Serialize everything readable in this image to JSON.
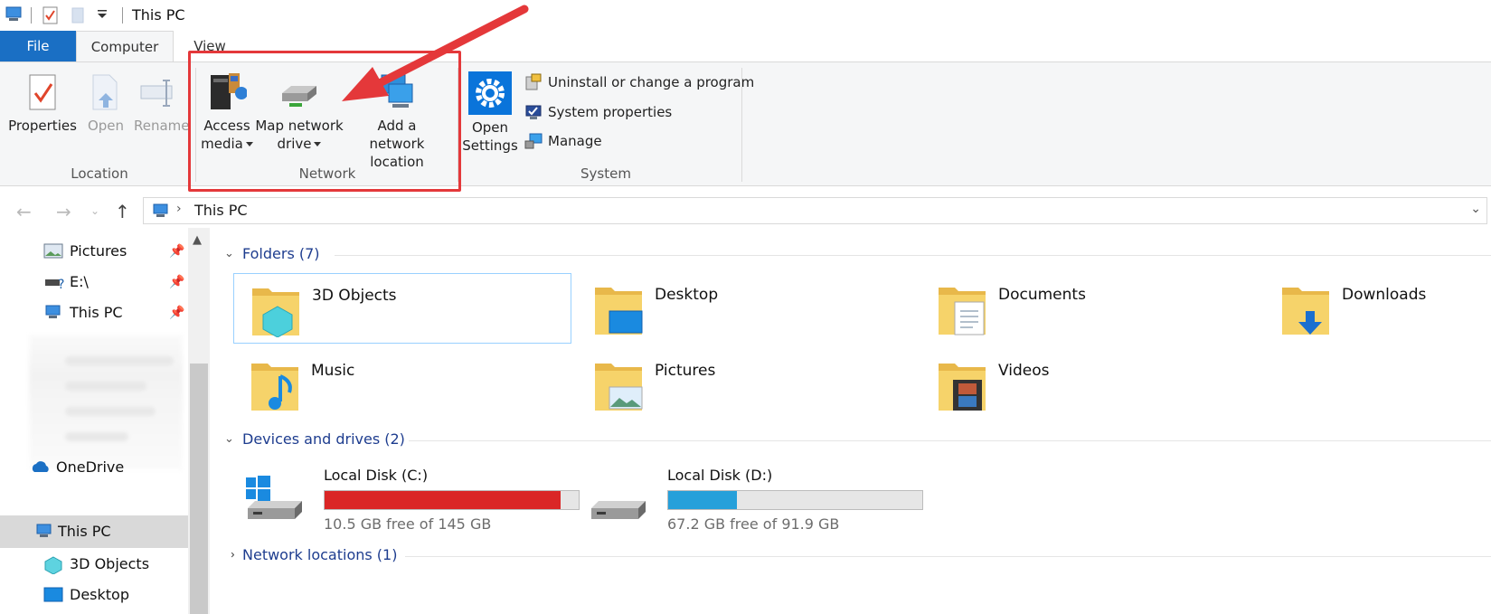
{
  "window": {
    "title": "This PC"
  },
  "tabs": {
    "file": "File",
    "computer": "Computer",
    "view": "View"
  },
  "ribbon": {
    "location": {
      "label": "Location",
      "properties": "Properties",
      "open": "Open",
      "rename": "Rename"
    },
    "network": {
      "label": "Network",
      "access_media": [
        "Access",
        "media"
      ],
      "map_network_drive": [
        "Map network",
        "drive"
      ],
      "add_network_location": [
        "Add a network",
        "location"
      ]
    },
    "system": {
      "label": "System",
      "open_settings": [
        "Open",
        "Settings"
      ],
      "uninstall": "Uninstall or change a program",
      "system_properties": "System properties",
      "manage": "Manage"
    }
  },
  "address": {
    "path": "This PC"
  },
  "nav": {
    "pinned": [
      "Pictures",
      "E:\\",
      "This PC"
    ],
    "onedrive": "OneDrive",
    "this_pc": "This PC",
    "objects_3d": "3D Objects",
    "desktop": "Desktop"
  },
  "content": {
    "folders_header": "Folders (7)",
    "folders": [
      "3D Objects",
      "Desktop",
      "Documents",
      "Downloads",
      "Music",
      "Pictures",
      "Videos"
    ],
    "devices_header": "Devices and drives (2)",
    "drives": [
      {
        "name": "Local Disk (C:)",
        "free": "10.5 GB free of 145 GB",
        "used_fraction": 0.928,
        "color": "#da2626"
      },
      {
        "name": "Local Disk (D:)",
        "free": "67.2 GB free of 91.9 GB",
        "used_fraction": 0.269,
        "color": "#26a0da"
      }
    ],
    "network_header": "Network locations (1)"
  },
  "colors": {
    "accent": "#1a6fc4",
    "highlight": "#e4383a",
    "link": "#1e3d8f"
  }
}
